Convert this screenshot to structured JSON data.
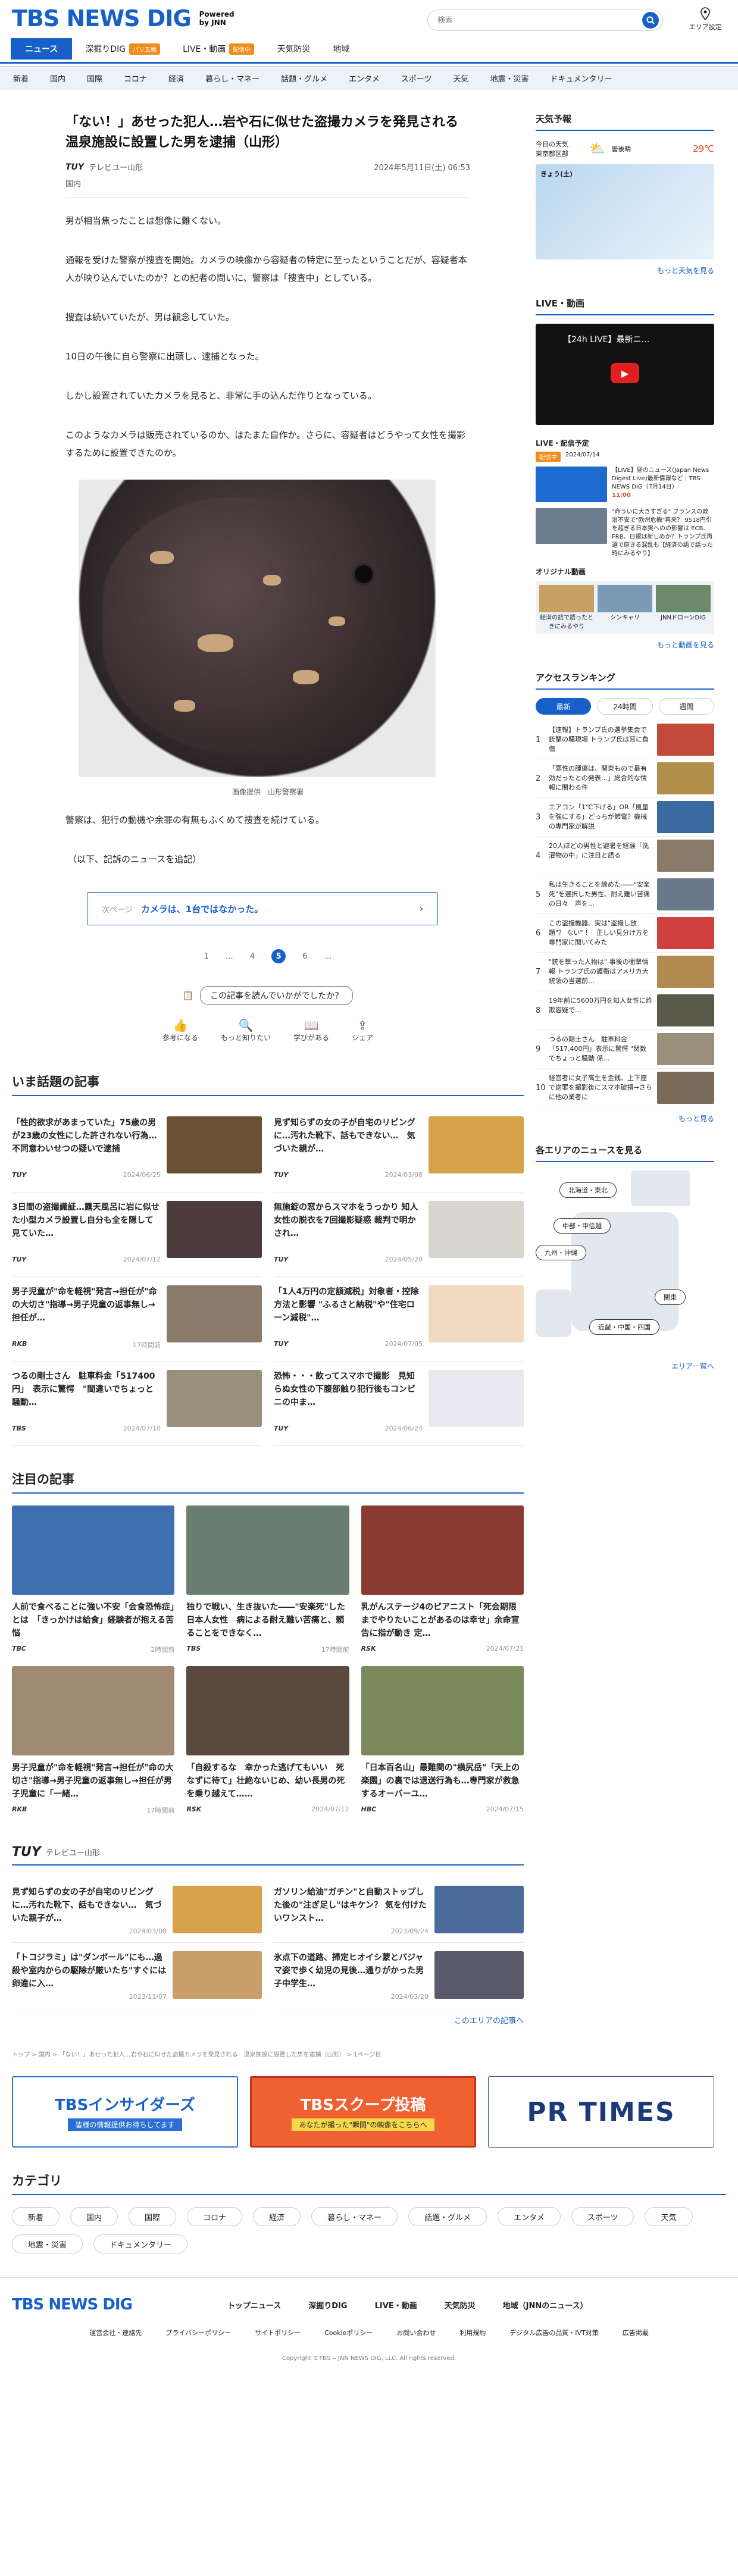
{
  "header": {
    "logo": "TBS NEWS DIG",
    "powered_by": "Powered by JNN",
    "search_placeholder": "検索",
    "area_label": "エリア設定"
  },
  "tabs": [
    {
      "label": "ニュース"
    },
    {
      "label": "深掘りDIG",
      "badge": "パリ五輪",
      "badge_color": "#f08c1b"
    },
    {
      "label": "LIVE・動画",
      "badge": "配信中",
      "badge_color": "#f08c1b"
    },
    {
      "label": "天気防災"
    },
    {
      "label": "地域"
    }
  ],
  "categories": [
    "新着",
    "国内",
    "国際",
    "コロナ",
    "経済",
    "暮らし・マネー",
    "話題・グルメ",
    "エンタメ",
    "スポーツ",
    "天気",
    "地震・災害",
    "ドキュメンタリー"
  ],
  "article": {
    "title": "「ない！」あせった犯人…岩や石に似せた盗撮カメラを発見される　温泉施設に設置した男を逮捕（山形）",
    "source": "テレビユー山形",
    "source_logo": "TUY",
    "date": "2024年5月11日(土) 06:53",
    "category": "国内",
    "paragraphs": [
      "男が相当焦ったことは想像に難くない。",
      "通報を受けた警察が捜査を開始。カメラの映像から容疑者の特定に至ったということだが、容疑者本人が映り込んでいたのか？との記者の問いに、警察は「捜査中」としている。",
      "捜査は続いていたが、男は観念していた。",
      "10日の午後に自ら警察に出頭し、逮捕となった。",
      "しかし設置されていたカメラを見ると、非常に手の込んだ作りとなっている。",
      "このようなカメラは販売されているのか、はたまた自作か。さらに、容疑者はどうやって女性を撮影するために設置できたのか。"
    ],
    "caption": "画像提供　山形警察署",
    "after": [
      "警察は、犯行の動機や余罪の有無もふくめて捜査を続けている。",
      "（以下、記訴のニュースを追記）"
    ],
    "related_label": "次ページ",
    "related_title": "カメラは、1台ではなかった。",
    "pages": [
      "1",
      "…",
      "4",
      "5",
      "6",
      "…"
    ],
    "survey_q": "この記事を読んでいかがでしたか？",
    "reactions": [
      "参考になる",
      "もっと知りたい",
      "学びがある",
      "シェア"
    ]
  },
  "hot": {
    "title": "いま話題の記事",
    "items": [
      {
        "text": "「性的欲求があまっていた」75歳の男が23歳の女性にした許されない行為…不同意わいせつの疑いで逮捕",
        "src": "TUY",
        "date": "2024/06/25",
        "color": "#6a5035"
      },
      {
        "text": "見ず知らずの女の子が自宅のリビングに…汚れた靴下、話もできない…　気づいた親が…",
        "src": "TUY",
        "date": "2024/03/08",
        "color": "#d6a24a"
      },
      {
        "text": "3日間の盗撮識証…露天風呂に岩に似せた小型カメラ設置し自分も全を隠して見ていた…",
        "src": "TUY",
        "date": "2024/07/12",
        "color": "#4c3c3e"
      },
      {
        "text": "無施錠の窓からスマホをうっかり 知人女性の脱衣を7回撮影疑惑 裁判で明かされ…",
        "src": "TUY",
        "date": "2024/05/20",
        "color": "#d8d5cf"
      },
      {
        "text": "男子児童が\"命を軽視\"発言→担任が\"命の大切さ\"指導→男子児童の返事無し→担任が…",
        "src": "RKB",
        "date": "17時間前",
        "color": "#8a7a6a"
      },
      {
        "text": "「1人4万円の定額減税」対象者・控除方法と影響 \"ふるさと納税\"や\"住宅ローン減税\"…",
        "src": "TUY",
        "date": "2024/07/05",
        "color": "#f2d9c1"
      },
      {
        "text": "つるの剛士さん　駐車料金「517400円」　表示に驚愕　\"間違いでちょっと騒動…",
        "src": "TBS",
        "date": "2024/07/10",
        "color": "#9a8f7a"
      },
      {
        "text": "恐怖・・・飲ってスマホで撮影　見知らぬ女性の下腹部触り犯行後もコンビニの中ま…",
        "src": "TUY",
        "date": "2024/06/24",
        "color": "#e8e8ee"
      }
    ]
  },
  "notable": {
    "title": "注目の記事",
    "items": [
      {
        "text": "人前で食べることに強い不安「会食恐怖症」とは　「きっかけは給食」経験者が抱える苦悩",
        "src": "TBC",
        "date": "2時間前",
        "color": "#3e6fb0"
      },
      {
        "text": "独りで戦い、生き抜いた――\"安楽死\"した日本人女性　病による耐え難い苦痛と、頼ることをできなく…",
        "src": "TBS",
        "date": "17時間前",
        "color": "#6a7f70"
      },
      {
        "text": "乳がんステージ4のピアニスト「死会期限までやりたいことがあるのは幸せ」余命宣告に指が動き 定…",
        "src": "RSK",
        "date": "2024/07/21",
        "color": "#8a3a30"
      },
      {
        "text": "男子児童が\"命を軽視\"発言→担任が\"命の大切さ\"指導→男子児童の返事無し→担任が男子児童に「一緒…",
        "src": "RKB",
        "date": "17時間前",
        "color": "#a08a72"
      },
      {
        "text": "「自殺するな　幸かった逃げてもいい　死なずに待て」壮絶ないじめ、幼い長男の死を乗り越えて……",
        "src": "RSK",
        "date": "2024/07/12",
        "color": "#5a4a40"
      },
      {
        "text": "「日本百名山」最難関の\"横尻岳\"「天上の楽園」の裏では退送行為も…専門家が救急するオーバーユ…",
        "src": "HBC",
        "date": "2024/07/15",
        "color": "#7a8a5a"
      }
    ]
  },
  "local": {
    "label": "テレビユー山形",
    "logo": "TUY",
    "items": [
      {
        "text": "見ず知らずの女の子が自宅のリビングに…汚れた靴下、話もできない…　気づいた親子が…",
        "date": "2024/03/08",
        "color": "#d6a24a"
      },
      {
        "text": "ガソリン給油\"ガチン\"と自動ストップした後の\"注ぎ足し\"はキケン？ 気を付けたいワンスト…",
        "date": "2023/09/24",
        "color": "#4a6a9a"
      },
      {
        "text": "「トコジラミ」は\"ダンボール\"にも…過殺や室内からの駆除が厳いたち\"すぐには卵違に入…",
        "date": "2023/11/07",
        "color": "#c9a06a"
      },
      {
        "text": "氷点下の道路、掃定ヒオイシ蒙とバジャマ姿で歩く幼児の見後…通りがかった男子中学生…",
        "date": "2024/03/20",
        "color": "#5a5a6a"
      }
    ],
    "more": "このエリアの記事へ"
  },
  "breadcrumb": "トップ > 国内 > 「ない！」あせった犯人…岩や石に似せた盗撮カメラを発見される　温泉施設に設置した男を逮捕（山形） > 1ページ目",
  "banners": [
    {
      "title": "TBSインサイダーズ",
      "sub": "皆様の情報提供お待ちしてます"
    },
    {
      "title": "TBSスクープ投稿",
      "sub": "あなたが撮った\"瞬間\"の映像をこちらへ"
    },
    {
      "title": "PR TIMES",
      "sub": ""
    }
  ],
  "category_section": {
    "title": "カテゴリ",
    "items": [
      "新着",
      "国内",
      "国際",
      "コロナ",
      "経済",
      "暮らし・マネー",
      "話題・グルメ",
      "エンタメ",
      "スポーツ",
      "天気",
      "地震・災害",
      "ドキュメンタリー"
    ]
  },
  "footer": {
    "logo": "TBS NEWS DIG",
    "nav": [
      "トップニュース",
      "深掘りDIG",
      "LIVE・動画",
      "天気防災",
      "地域（JNNのニュース）"
    ],
    "links": [
      "運営会社・連絡先",
      "プライバシーポリシー",
      "サイトポリシー",
      "Cookieポリシー",
      "お問い合わせ",
      "利用規約",
      "デジタル広告の品質・IVT対策",
      "広告掲載"
    ],
    "copyright": "Copyright ©TBS ‒ JNN NEWS DIG, LLC. All rights reserved."
  },
  "sidebar": {
    "weather": {
      "title": "天気予報",
      "loc": "今日の天気\n東京都区部",
      "cond": "曇後晴",
      "temp": "29℃",
      "date": "きょう(土)",
      "more": "もっと天気を見る"
    },
    "live": {
      "title": "LIVE・動画",
      "video_title": "【24h LIVE】最新ニ…",
      "sched_label": "LIVE・配信予定",
      "sched_tag": "配信中",
      "sched_date": "2024/07/14",
      "item1": "【LIVE】昼のニュース(Japan News Digest Live)最新情報など｜TBS NEWS DIG（7月14日）",
      "item1_time": "11:00",
      "item2": "\"命ういに大きすぎる\" フランスの政治不安で\"欧州危機\"再来？ 9518円引を超ぎる日本樊へのの影響は ECB、FRB、日銀は新しめか？トランプ氏再選で原きる混乱も【経済の語で話った時にみるやり】",
      "item2_time": "21:00",
      "orig_title": "オリジナル動画",
      "orig": [
        "経済の詰で語ったときにみるやり",
        "シンキャリ",
        "JNNドローンDIG"
      ],
      "more": "もっと動画を見る"
    },
    "ranking": {
      "title": "アクセスランキング",
      "tabs": [
        "最新",
        "24時間",
        "週間"
      ],
      "items": [
        "【速報】トランプ氏の選挙集会で銃撃の騒現場 トランプ氏は耳に負傷",
        "「悪性の腫瘍は、関東もので最有効だったとの発表…」総合的な情報に関わる件",
        "エアコン「1℃下げる」OR「風量を強にする」どっちが節電？機械の専門家が解説",
        "20人ほどの男性と避暑を経験「洗濯物の中」に注目と語る",
        "私は生きることを諦めた――\"安楽死\"を選択した男性、耐え難い苦痛の日々　声を…",
        "この盗撮機器、実は\"盗撮し放題\"？ ない\" ! 　正しい見分け方を専門家に聞いてみた",
        "\"銃を撃った人物は\" 事後の衝撃情報 トランプ氏の護衛はアメリカ大統領の当選前…",
        "19年前に5600万円を知人女性に詐欺容疑で…",
        "つるの剛士さん　駐車料金「517,400円」表示に驚愕 \"関数でちょっと騒動 係…",
        "経営者に女子高生を金銭、上下座で謝罪を撮影後にスマホ破損→さらに他の業者に"
      ],
      "more": "もっと見る"
    },
    "areas": {
      "title": "各エリアのニュースを見る",
      "regions": [
        "北海道・東北",
        "中部・甲信越",
        "九州・沖縄",
        "関東",
        "近畿・中国・四国"
      ],
      "more": "エリア一覧へ"
    }
  }
}
